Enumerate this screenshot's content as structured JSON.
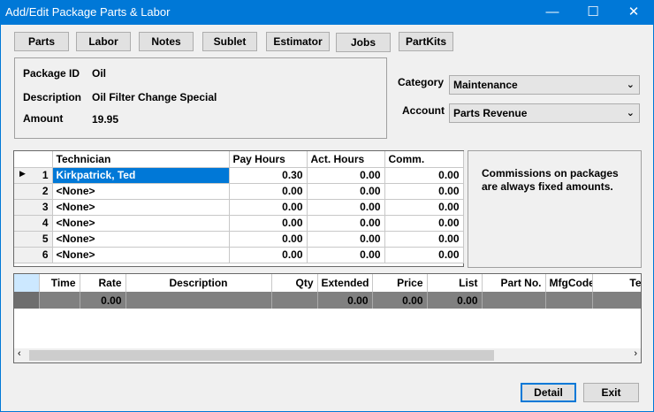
{
  "window": {
    "title": "Add/Edit Package Parts & Labor"
  },
  "tabs": [
    "Parts",
    "Labor",
    "Notes",
    "Sublet",
    "Estimator",
    "Jobs",
    "PartKits"
  ],
  "package": {
    "id_label": "Package ID",
    "id_value": "Oil",
    "desc_label": "Description",
    "desc_value": "Oil  Filter Change Special",
    "amount_label": "Amount",
    "amount_value": "19.95"
  },
  "category": {
    "label": "Category",
    "value": "Maintenance"
  },
  "account": {
    "label": "Account",
    "value": "Parts Revenue"
  },
  "technicians": {
    "headers": [
      "Technician",
      "Pay Hours",
      "Act. Hours",
      "Comm."
    ],
    "rows": [
      {
        "no": "1",
        "name": "Kirkpatrick, Ted",
        "pay": "0.30",
        "act": "0.00",
        "comm": "0.00"
      },
      {
        "no": "2",
        "name": "<None>",
        "pay": "0.00",
        "act": "0.00",
        "comm": "0.00"
      },
      {
        "no": "3",
        "name": "<None>",
        "pay": "0.00",
        "act": "0.00",
        "comm": "0.00"
      },
      {
        "no": "4",
        "name": "<None>",
        "pay": "0.00",
        "act": "0.00",
        "comm": "0.00"
      },
      {
        "no": "5",
        "name": "<None>",
        "pay": "0.00",
        "act": "0.00",
        "comm": "0.00"
      },
      {
        "no": "6",
        "name": "<None>",
        "pay": "0.00",
        "act": "0.00",
        "comm": "0.00"
      }
    ]
  },
  "note": "Commissions on packages are always fixed amounts.",
  "jobs": {
    "headers": [
      "",
      "Time",
      "Rate",
      "Description",
      "Qty",
      "Extended",
      "Price",
      "List",
      "Part No.",
      "MfgCode",
      "Tech N"
    ],
    "row": [
      "",
      "",
      "0.00",
      "",
      "",
      "0.00",
      "0.00",
      "0.00",
      "",
      "",
      ""
    ]
  },
  "buttons": {
    "detail": "Detail",
    "exit": "Exit"
  }
}
